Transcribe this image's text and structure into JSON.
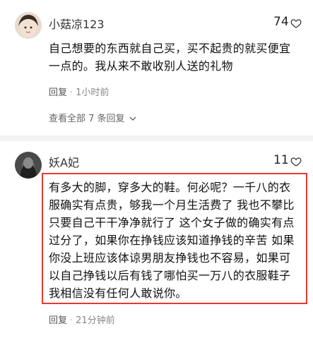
{
  "comments": [
    {
      "username": "小菇凉123",
      "likes": "74",
      "text_lines": [
        "自己想要的东西就自己买，买不起贵的就买便宜",
        "一点的。我从来不敢收别人送的礼物"
      ],
      "reply_label": "回复",
      "time": "1小时前",
      "view_all": "查看全部 7 条回复"
    },
    {
      "username": "妖A妃",
      "likes": "11",
      "text_lines": [
        "有多大的脚，穿多大的鞋。何必呢？一千八的衣",
        "服确实有点贵，够我一个月生活费了 我也不攀比",
        "只要自己干干净净就行了 这个女子做的确实有点",
        "过分了，如果你在挣钱应该知道挣钱的辛苦 如果",
        "你没上班应该体谅男朋友挣钱也不容易，如果可",
        "以自己挣钱以后有钱了哪怕买一万八的衣服鞋子",
        "我相信没有任何人敢说你。"
      ],
      "reply_label": "回复",
      "time": "21分钟前"
    }
  ],
  "colors": {
    "highlight": "#e53935",
    "meta": "#888888"
  },
  "icons": [
    "heart-outline-icon",
    "chevron-down-icon"
  ]
}
